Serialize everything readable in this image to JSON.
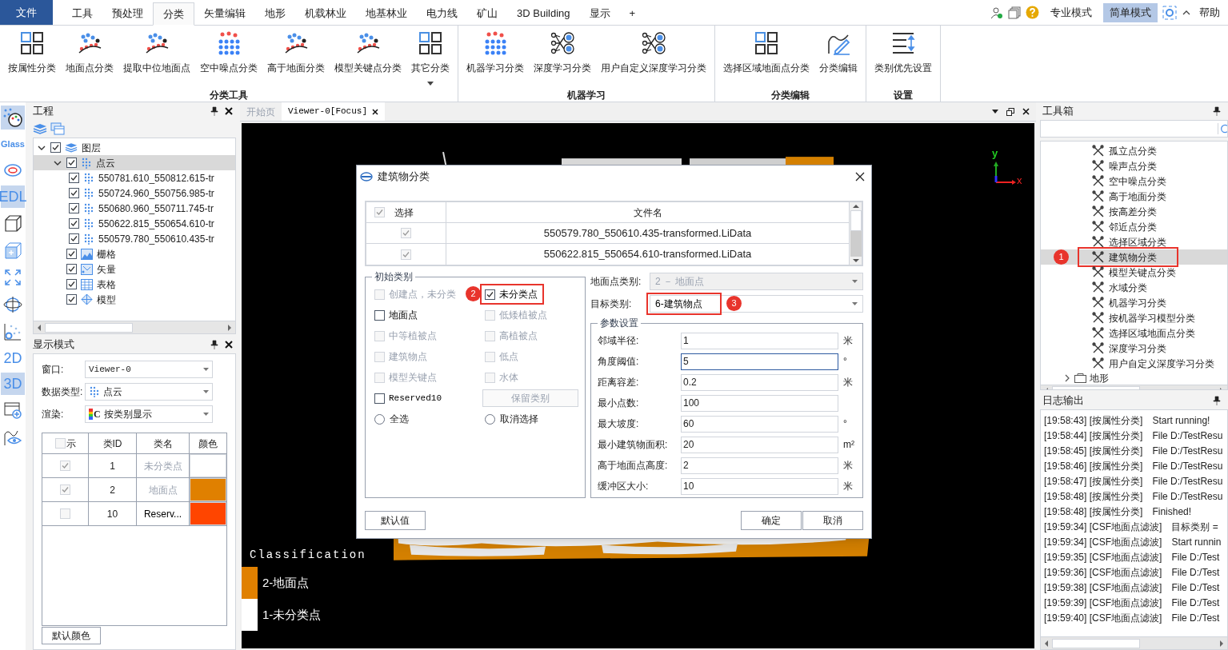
{
  "menu_tabs": [
    {
      "label": "文件",
      "kind": "file",
      "selected": false
    },
    {
      "label": "工具",
      "kind": "tab",
      "selected": false
    },
    {
      "label": "预处理",
      "kind": "tab",
      "selected": false
    },
    {
      "label": "分类",
      "kind": "tab",
      "selected": true
    },
    {
      "label": "矢量编辑",
      "kind": "tab",
      "selected": false
    },
    {
      "label": "地形",
      "kind": "tab",
      "selected": false
    },
    {
      "label": "机载林业",
      "kind": "tab",
      "selected": false
    },
    {
      "label": "地基林业",
      "kind": "tab",
      "selected": false
    },
    {
      "label": "电力线",
      "kind": "tab",
      "selected": false
    },
    {
      "label": "矿山",
      "kind": "tab",
      "selected": false
    },
    {
      "label": "3D Building",
      "kind": "tab",
      "selected": false
    },
    {
      "label": "显示",
      "kind": "tab",
      "selected": false
    },
    {
      "label": "+",
      "kind": "tab",
      "selected": false
    }
  ],
  "mode_buttons": [
    {
      "label": "专业模式",
      "selected": false
    },
    {
      "label": "简单模式",
      "selected": true
    }
  ],
  "help": "帮助",
  "ribbon_groups": [
    {
      "label": "分类工具",
      "buttons": [
        {
          "label": "按属性分类",
          "dropdown": false
        },
        {
          "label": "地面点分类",
          "dropdown": false
        },
        {
          "label": "提取中位地面点",
          "dropdown": false
        },
        {
          "label": "空中噪点分类",
          "dropdown": false
        },
        {
          "label": "高于地面分类",
          "dropdown": false
        },
        {
          "label": "模型关键点分类",
          "dropdown": false
        },
        {
          "label": "其它分类",
          "dropdown": true
        }
      ]
    },
    {
      "label": "机器学习",
      "buttons": [
        {
          "label": "机器学习分类",
          "dropdown": false
        },
        {
          "label": "深度学习分类",
          "dropdown": false
        },
        {
          "label": "用户自定义深度学习分类",
          "dropdown": false
        }
      ]
    },
    {
      "label": "分类编辑",
      "buttons": [
        {
          "label": "选择区域地面点分类",
          "dropdown": false
        },
        {
          "label": "分类编辑",
          "dropdown": false
        }
      ]
    },
    {
      "label": "设置",
      "buttons": [
        {
          "label": "类别优先设置",
          "dropdown": false
        }
      ]
    }
  ],
  "tool_strip": [
    {
      "kind": "icon",
      "selected": true
    },
    {
      "kind": "text",
      "label": "Glass",
      "selected": false
    },
    {
      "kind": "icon",
      "selected": false
    },
    {
      "kind": "text",
      "label": "EDL",
      "selected": true
    },
    {
      "kind": "icon",
      "selected": false
    },
    {
      "kind": "icon",
      "selected": false
    },
    {
      "kind": "icon",
      "selected": false
    },
    {
      "kind": "icon",
      "selected": false
    },
    {
      "kind": "icon",
      "selected": false
    },
    {
      "kind": "text",
      "label": "2D",
      "selected": false
    },
    {
      "kind": "text",
      "label": "3D",
      "selected": true
    },
    {
      "kind": "icon",
      "selected": false
    },
    {
      "kind": "icon",
      "selected": false
    }
  ],
  "project_panel": {
    "title": "工程",
    "tree": [
      {
        "label": "图层",
        "kind": "group",
        "checked": true,
        "expanded": true,
        "selected": false,
        "children": [
          {
            "label": "点云",
            "kind": "pointcloud",
            "checked": true,
            "expanded": true,
            "selected": true,
            "children": [
              {
                "label": "550781.610_550812.615-tr",
                "kind": "file",
                "checked": true,
                "selected": false
              },
              {
                "label": "550724.960_550756.985-tr",
                "kind": "file",
                "checked": true,
                "selected": false
              },
              {
                "label": "550680.960_550711.745-tr",
                "kind": "file",
                "checked": true,
                "selected": false
              },
              {
                "label": "550622.815_550654.610-tr",
                "kind": "file",
                "checked": true,
                "selected": false
              },
              {
                "label": "550579.780_550610.435-tr",
                "kind": "file",
                "checked": true,
                "selected": false
              }
            ]
          },
          {
            "label": "栅格",
            "kind": "raster",
            "checked": true,
            "selected": false
          },
          {
            "label": "矢量",
            "kind": "vector",
            "checked": true,
            "selected": false
          },
          {
            "label": "表格",
            "kind": "table",
            "checked": true,
            "selected": false
          },
          {
            "label": "模型",
            "kind": "model",
            "checked": true,
            "selected": false
          }
        ]
      }
    ]
  },
  "display_panel": {
    "title": "显示模式",
    "fields": [
      {
        "label": "窗口:",
        "value": "Viewer-0",
        "kind": "mono"
      },
      {
        "label": "数据类型:",
        "value": "点云",
        "kind": "pointcloud"
      },
      {
        "label": "渲染:",
        "value": "按类别显示",
        "kind": "classes",
        "icon_letter": "C"
      }
    ],
    "table": {
      "select_all": false,
      "columns": [
        "示",
        "类ID",
        "类名",
        "颜色"
      ],
      "rows": [
        {
          "checked": true,
          "id": "1",
          "name": "未分类点",
          "dimmed": true,
          "color": "#ffffff"
        },
        {
          "checked": true,
          "id": "2",
          "name": "地面点",
          "dimmed": true,
          "color": "#e08000"
        },
        {
          "checked": false,
          "id": "10",
          "name": "Reserv...",
          "dimmed": false,
          "color": "#ff4500"
        }
      ]
    },
    "button": "默认颜色"
  },
  "viewer": {
    "tabs": [
      {
        "label": "开始页",
        "selected": false,
        "closable": false
      },
      {
        "label": "Viewer-0[Focus]",
        "selected": true,
        "closable": true
      }
    ],
    "axes": {
      "y": "y",
      "x": "x"
    },
    "legend": {
      "title": "Classification",
      "items": [
        {
          "label": "2-地面点",
          "color": "#e08000"
        },
        {
          "label": "1-未分类点",
          "color": "#ffffff"
        }
      ]
    }
  },
  "dialog": {
    "title": "建筑物分类",
    "files": {
      "select_all": true,
      "columns": [
        "选择",
        "文件名"
      ],
      "rows": [
        {
          "checked": true,
          "name": "550579.780_550610.435-transformed.LiData"
        },
        {
          "checked": true,
          "name": "550622.815_550654.610-transformed.LiData"
        }
      ]
    },
    "initial_classes": {
      "title": "初始类别",
      "items": [
        {
          "kind": "checkbox",
          "label": "创建点，未分类",
          "checked": false,
          "disabled": true,
          "highlighted": false
        },
        {
          "kind": "checkbox",
          "label": "未分类点",
          "checked": true,
          "disabled": false,
          "highlighted": true,
          "callout": "2"
        },
        {
          "kind": "checkbox",
          "label": "地面点",
          "checked": false,
          "disabled": false,
          "highlighted": false
        },
        {
          "kind": "checkbox",
          "label": "低矮植被点",
          "checked": false,
          "disabled": true,
          "highlighted": false
        },
        {
          "kind": "checkbox",
          "label": "中等植被点",
          "checked": false,
          "disabled": true,
          "highlighted": false
        },
        {
          "kind": "checkbox",
          "label": "高植被点",
          "checked": false,
          "disabled": true,
          "highlighted": false
        },
        {
          "kind": "checkbox",
          "label": "建筑物点",
          "checked": false,
          "disabled": true,
          "highlighted": false
        },
        {
          "kind": "checkbox",
          "label": "低点",
          "checked": false,
          "disabled": true,
          "highlighted": false
        },
        {
          "kind": "checkbox",
          "label": "模型关键点",
          "checked": false,
          "disabled": true,
          "highlighted": false
        },
        {
          "kind": "checkbox",
          "label": "水体",
          "checked": false,
          "disabled": true,
          "highlighted": false
        },
        {
          "kind": "checkbox",
          "label": "Reserved10",
          "checked": false,
          "disabled": false,
          "highlighted": false
        },
        {
          "kind": "button",
          "label": "保留类别",
          "disabled": true
        },
        {
          "kind": "radio",
          "label": "全选",
          "checked": false
        },
        {
          "kind": "radio",
          "label": "取消选择",
          "checked": false
        }
      ]
    },
    "ground_class": {
      "label": "地面点类别:",
      "value": "2 － 地面点",
      "disabled": true,
      "highlighted": false
    },
    "target_class": {
      "label": "目标类别:",
      "value": "6-建筑物点",
      "disabled": false,
      "highlighted": true,
      "callout": "3"
    },
    "params": {
      "title": "参数设置",
      "rows": [
        {
          "label": "邻域半径:",
          "value": "1",
          "unit": "米",
          "focused": false
        },
        {
          "label": "角度阈值:",
          "value": "5",
          "unit": "°",
          "focused": true
        },
        {
          "label": "距离容差:",
          "value": "0.2",
          "unit": "米",
          "focused": false
        },
        {
          "label": "最小点数:",
          "value": "100",
          "focused": false
        },
        {
          "label": "最大坡度:",
          "value": "60",
          "unit": "°",
          "focused": false
        },
        {
          "label": "最小建筑物面积:",
          "value": "20",
          "unit": "m²",
          "focused": false
        },
        {
          "label": "高于地面点高度:",
          "value": "2",
          "unit": "米",
          "focused": false
        },
        {
          "label": "缓冲区大小:",
          "value": "10",
          "unit": "米",
          "focused": false
        }
      ]
    },
    "buttons": [
      "默认值",
      "确定",
      "取消"
    ]
  },
  "toolbox": {
    "title": "工具箱",
    "tools": [
      {
        "label": "孤立点分类",
        "selected": false,
        "highlighted": false
      },
      {
        "label": "噪声点分类",
        "selected": false,
        "highlighted": false
      },
      {
        "label": "空中噪点分类",
        "selected": false,
        "highlighted": false
      },
      {
        "label": "高于地面分类",
        "selected": false,
        "highlighted": false
      },
      {
        "label": "按高差分类",
        "selected": false,
        "highlighted": false
      },
      {
        "label": "邻近点分类",
        "selected": false,
        "highlighted": false
      },
      {
        "label": "选择区域分类",
        "selected": false,
        "highlighted": false
      },
      {
        "label": "建筑物分类",
        "selected": true,
        "highlighted": true,
        "callout": "1"
      },
      {
        "label": "模型关键点分类",
        "selected": false,
        "highlighted": false
      },
      {
        "label": "水域分类",
        "selected": false,
        "highlighted": false
      },
      {
        "label": "机器学习分类",
        "selected": false,
        "highlighted": false
      },
      {
        "label": "按机器学习模型分类",
        "selected": false,
        "highlighted": false
      },
      {
        "label": "选择区域地面点分类",
        "selected": false,
        "highlighted": false
      },
      {
        "label": "深度学习分类",
        "selected": false,
        "highlighted": false
      },
      {
        "label": "用户自定义深度学习分类",
        "selected": false,
        "highlighted": false
      }
    ],
    "next_category": "地形"
  },
  "log": {
    "title": "日志输出",
    "lines": [
      {
        "prefix": "[19:58:43] [按属性分类]",
        "message": "Start running!"
      },
      {
        "prefix": "[19:58:44] [按属性分类]",
        "message": "File D:/TestResu"
      },
      {
        "prefix": "[19:58:45] [按属性分类]",
        "message": "File D:/TestResu"
      },
      {
        "prefix": "[19:58:46] [按属性分类]",
        "message": "File D:/TestResu"
      },
      {
        "prefix": "[19:58:47] [按属性分类]",
        "message": "File D:/TestResu"
      },
      {
        "prefix": "[19:58:48] [按属性分类]",
        "message": "File D:/TestResu"
      },
      {
        "prefix": "[19:58:48] [按属性分类]",
        "message": "Finished!"
      },
      {
        "prefix": "[19:59:34] [CSF地面点滤波]",
        "message": "目标类别 ="
      },
      {
        "prefix": "[19:59:34] [CSF地面点滤波]",
        "message": "Start runnin"
      },
      {
        "prefix": "[19:59:35] [CSF地面点滤波]",
        "message": "File D:/Test"
      },
      {
        "prefix": "[19:59:36] [CSF地面点滤波]",
        "message": "File D:/Test"
      },
      {
        "prefix": "[19:59:38] [CSF地面点滤波]",
        "message": "File D:/Test"
      },
      {
        "prefix": "[19:59:39] [CSF地面点滤波]",
        "message": "File D:/Test"
      },
      {
        "prefix": "[19:59:40] [CSF地面点滤波]",
        "message": "File D:/Test"
      }
    ]
  }
}
